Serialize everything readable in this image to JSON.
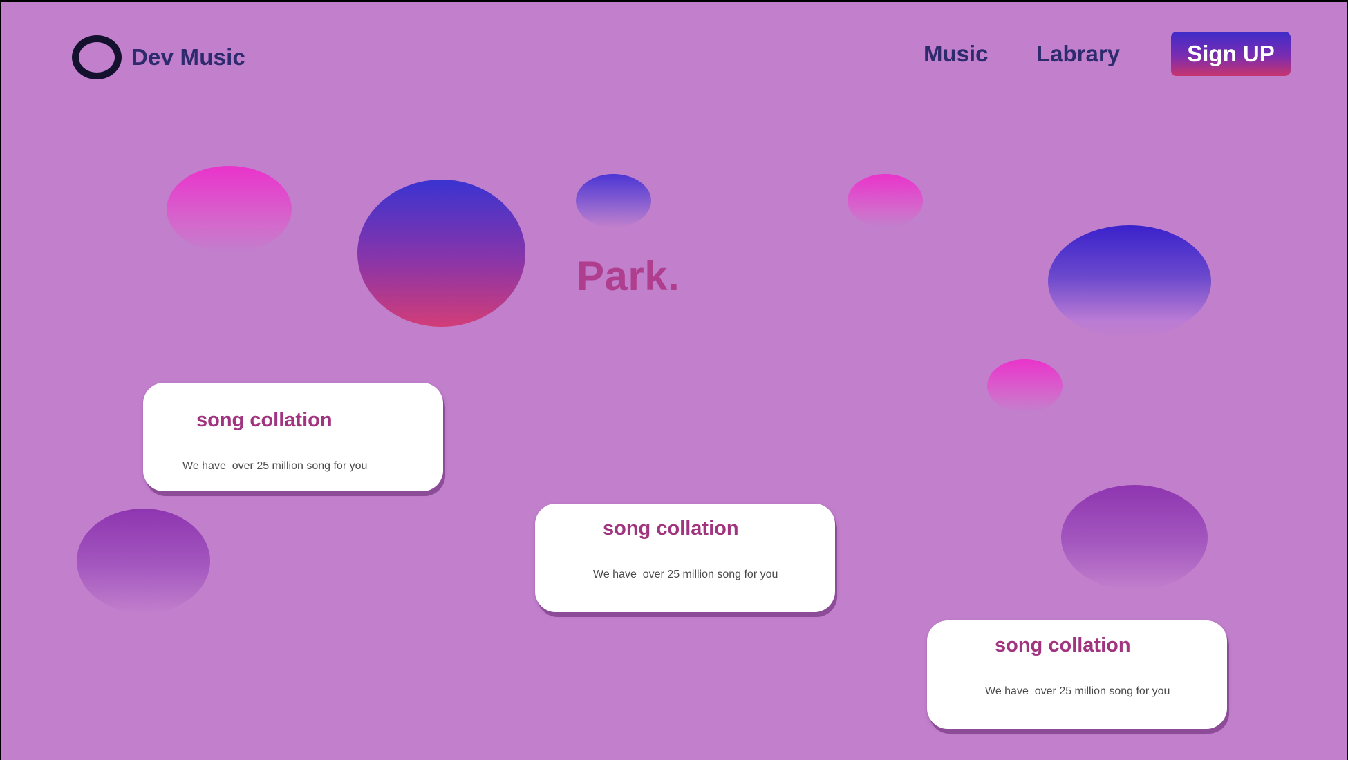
{
  "brand": {
    "name": "Dev Music",
    "logo_icon": "ring-logo-icon"
  },
  "nav": {
    "music": "Music",
    "library": "Labrary",
    "signup": "Sign UP"
  },
  "hero": {
    "title": "Park."
  },
  "cards": [
    {
      "title": "song collation",
      "text": "We have  over 25 million song for you"
    },
    {
      "title": "song collation",
      "text": "We have  over 25 million song for you"
    },
    {
      "title": "song collation",
      "text": "We have  over 25 million song for you"
    }
  ],
  "colors": {
    "background": "#c17fcc",
    "nav_text": "#2d2a6e",
    "accent_title": "#b03e8e",
    "card_title": "#a0347f",
    "card_bg": "#ffffff",
    "button_gradient_top": "#3f2bc9",
    "button_gradient_bottom": "#c8356e"
  }
}
